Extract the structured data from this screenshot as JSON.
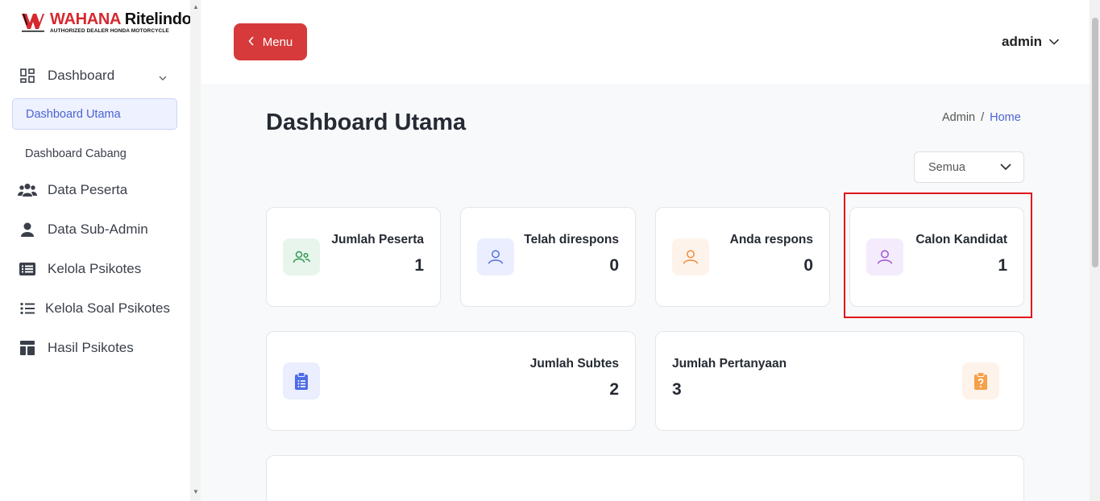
{
  "brand": {
    "name_part1": "WAHANA",
    "name_part2": "Ritelindo",
    "tagline": "AUTHORIZED DEALER HONDA MOTORCYCLE",
    "red": "#d6282f"
  },
  "sidebar": {
    "dashboard_label": "Dashboard",
    "sub_items": [
      {
        "label": "Dashboard Utama",
        "active": true
      },
      {
        "label": "Dashboard Cabang",
        "active": false
      }
    ],
    "items": [
      {
        "label": "Data Peserta",
        "icon": "users-icon"
      },
      {
        "label": "Data Sub-Admin",
        "icon": "user-icon"
      },
      {
        "label": "Kelola Psikotes",
        "icon": "list-box-icon"
      },
      {
        "label": "Kelola Soal Psikotes",
        "icon": "list-icon"
      },
      {
        "label": "Hasil Psikotes",
        "icon": "layout-icon"
      }
    ]
  },
  "topbar": {
    "menu_label": "Menu",
    "user_label": "admin",
    "menu_color": "#d63a3a"
  },
  "page": {
    "title": "Dashboard Utama",
    "breadcrumb": {
      "parent": "Admin",
      "separator": "/",
      "current": "Home"
    },
    "filter_value": "Semua"
  },
  "stats": [
    {
      "label": "Jumlah Peserta",
      "value": "1",
      "icon": "users-icon",
      "color": "#2e9a55"
    },
    {
      "label": "Telah direspons",
      "value": "0",
      "icon": "user-icon",
      "color": "#5470e0"
    },
    {
      "label": "Anda respons",
      "value": "0",
      "icon": "user-icon",
      "color": "#f08a3c"
    },
    {
      "label": "Calon Kandidat",
      "value": "1",
      "icon": "user-icon",
      "color": "#9a55d6"
    }
  ],
  "wide_stats": [
    {
      "label": "Jumlah Subtes",
      "value": "2",
      "icon": "clipboard-list-icon",
      "color": "#4f6de6"
    },
    {
      "label": "Jumlah Pertanyaan",
      "value": "3",
      "icon": "clipboard-question-icon",
      "color": "#f5a04a"
    }
  ]
}
